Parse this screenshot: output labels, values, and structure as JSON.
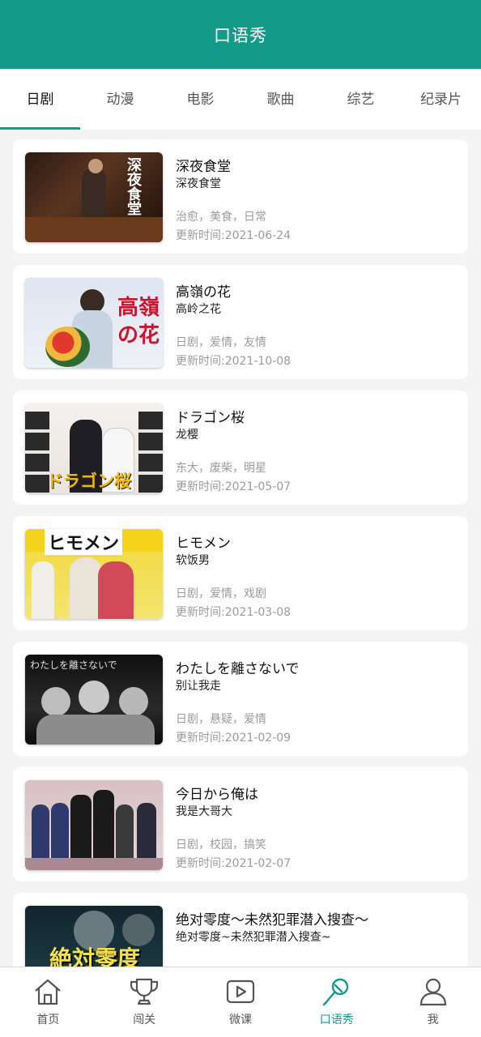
{
  "header": {
    "title": "口语秀"
  },
  "tabs": [
    {
      "label": "日剧",
      "active": true
    },
    {
      "label": "动漫"
    },
    {
      "label": "电影"
    },
    {
      "label": "歌曲"
    },
    {
      "label": "综艺"
    },
    {
      "label": "纪录片"
    }
  ],
  "items": [
    {
      "title": "深夜食堂",
      "subtitle": "深夜食堂",
      "tags": "治愈，美食，日常",
      "date": "更新时间:2021-06-24",
      "thumb_text": "深夜食堂"
    },
    {
      "title": "高嶺の花",
      "subtitle": "高岭之花",
      "tags": "日剧，爱情，友情",
      "date": "更新时间:2021-10-08",
      "thumb_text": "高嶺の花"
    },
    {
      "title": "ドラゴン桜",
      "subtitle": "龙樱",
      "tags": "东大，废柴，明星",
      "date": "更新时间:2021-05-07",
      "thumb_text": "ドラゴン桜"
    },
    {
      "title": "ヒモメン",
      "subtitle": "软饭男",
      "tags": "日剧，爱情，戏剧",
      "date": "更新时间:2021-03-08",
      "thumb_text": "ヒモメン"
    },
    {
      "title": "わたしを離さないで",
      "subtitle": "别让我走",
      "tags": "日剧，悬疑，爱情",
      "date": "更新时间:2021-02-09",
      "thumb_text": "わたしを離さないで"
    },
    {
      "title": "今日から俺は",
      "subtitle": "我是大哥大",
      "tags": "日剧，校园，搞笑",
      "date": "更新时间:2021-02-07",
      "thumb_text": ""
    },
    {
      "title": "绝对零度～未然犯罪潜入搜查～",
      "subtitle": "绝对零度~未然犯罪潜入搜查~",
      "tags": "",
      "date": "",
      "thumb_text": "絶対零度"
    }
  ],
  "bottom_nav": [
    {
      "label": "首页",
      "icon": "home-icon"
    },
    {
      "label": "闯关",
      "icon": "trophy-icon"
    },
    {
      "label": "微课",
      "icon": "play-icon"
    },
    {
      "label": "口语秀",
      "icon": "microphone-icon",
      "active": true
    },
    {
      "label": "我",
      "icon": "user-icon"
    }
  ],
  "colors": {
    "accent": "#149a88",
    "muted": "#9a9a9a"
  }
}
